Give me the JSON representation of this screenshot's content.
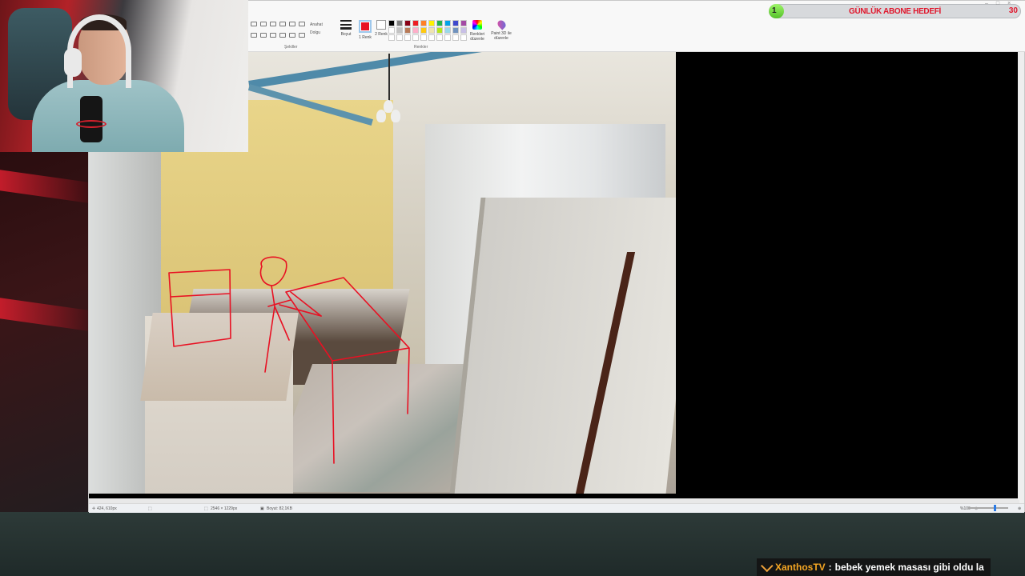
{
  "paint": {
    "ribbon": {
      "shapes_label": "Şekiller",
      "colors_label": "Renkler",
      "outline_label": "Anahat",
      "fill_label": "Dolgu",
      "size_label": "Boyut",
      "color1_label": "1 Renk",
      "color2_label": "2 Renk",
      "edit_colors_label": "Renkleri düzenle",
      "paint3d_label": "Paint 3D ile düzenle",
      "color1_value": "#e81123",
      "palette": [
        "#000000",
        "#7f7f7f",
        "#880015",
        "#ed1c24",
        "#ff7f27",
        "#fff200",
        "#22b14c",
        "#00a2e8",
        "#3f48cc",
        "#a349a4",
        "#ffffff",
        "#c3c3c3",
        "#b97a57",
        "#ffaec9",
        "#ffc90e",
        "#efe4b0",
        "#b5e61d",
        "#99d9ea",
        "#7092be",
        "#c8bfe7",
        "#ffffff",
        "#ffffff",
        "#ffffff",
        "#ffffff",
        "#ffffff",
        "#ffffff",
        "#ffffff",
        "#ffffff",
        "#ffffff",
        "#ffffff"
      ]
    },
    "status": {
      "cursor_pos": "424, 610px",
      "canvas_size": "2546 × 1229px",
      "file_size": "Boyut: 82,1KB",
      "zoom": "%100"
    }
  },
  "overlay": {
    "goal": {
      "label": "GÜNLÜK ABONE HEDEFİ",
      "current": "1",
      "target": "30",
      "fill_fraction": 0.033
    },
    "chat": {
      "user": "XanthosTV",
      "separator": ":",
      "message": "bebek yemek masası gibi oldu la"
    }
  }
}
